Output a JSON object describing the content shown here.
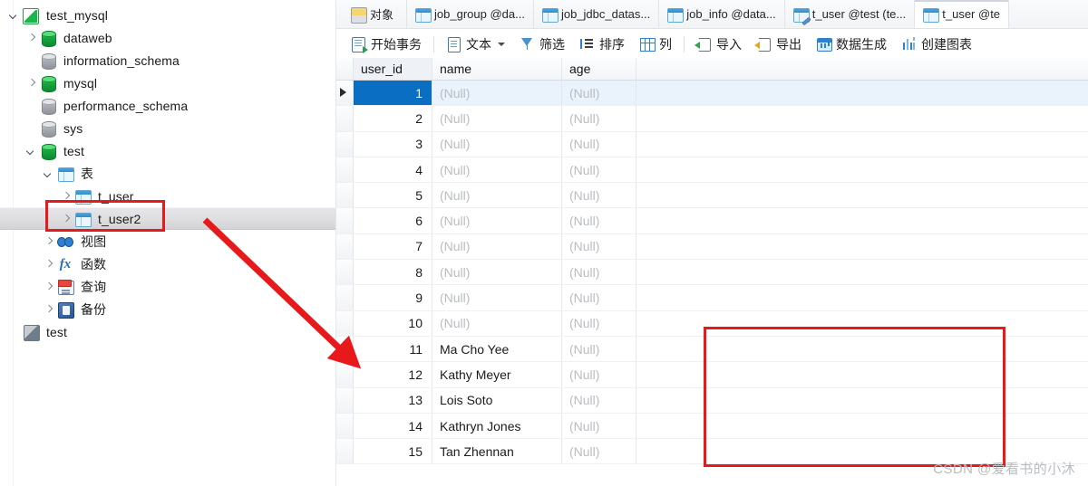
{
  "sidebar": {
    "tree": [
      {
        "label": "test_mysql",
        "icon": "connection-icon",
        "indent": 0,
        "chevron": "down",
        "selected": false,
        "cjk": false
      },
      {
        "label": "dataweb",
        "icon": "database-green-icon",
        "indent": 1,
        "chevron": "right",
        "selected": false,
        "cjk": false
      },
      {
        "label": "information_schema",
        "icon": "database-grey-icon",
        "indent": 1,
        "chevron": "none",
        "selected": false,
        "cjk": false
      },
      {
        "label": "mysql",
        "icon": "database-green-icon",
        "indent": 1,
        "chevron": "right",
        "selected": false,
        "cjk": false
      },
      {
        "label": "performance_schema",
        "icon": "database-grey-icon",
        "indent": 1,
        "chevron": "none",
        "selected": false,
        "cjk": false
      },
      {
        "label": "sys",
        "icon": "database-grey-icon",
        "indent": 1,
        "chevron": "none",
        "selected": false,
        "cjk": false
      },
      {
        "label": "test",
        "icon": "database-green-icon",
        "indent": 1,
        "chevron": "down",
        "selected": false,
        "cjk": false
      },
      {
        "label": "表",
        "icon": "table-folder-icon",
        "indent": 2,
        "chevron": "down",
        "selected": false,
        "cjk": true
      },
      {
        "label": "t_user",
        "icon": "table-icon",
        "indent": 3,
        "chevron": "right",
        "selected": false,
        "cjk": false
      },
      {
        "label": "t_user2",
        "icon": "table-icon",
        "indent": 3,
        "chevron": "right",
        "selected": true,
        "cjk": false
      },
      {
        "label": "视图",
        "icon": "view-icon",
        "indent": 2,
        "chevron": "right",
        "selected": false,
        "cjk": true
      },
      {
        "label": "函数",
        "icon": "function-icon",
        "indent": 2,
        "chevron": "right",
        "selected": false,
        "cjk": true
      },
      {
        "label": "查询",
        "icon": "query-icon",
        "indent": 2,
        "chevron": "right",
        "selected": false,
        "cjk": true
      },
      {
        "label": "备份",
        "icon": "backup-icon",
        "indent": 2,
        "chevron": "right",
        "selected": false,
        "cjk": true
      },
      {
        "label": "test",
        "icon": "model-icon",
        "indent": 0,
        "chevron": "none",
        "selected": false,
        "cjk": false
      }
    ]
  },
  "tabs": [
    {
      "label": "对象",
      "icon": "objects-icon",
      "active": false
    },
    {
      "label": "job_group @da...",
      "icon": "table-icon",
      "active": false
    },
    {
      "label": "job_jdbc_datas...",
      "icon": "table-icon",
      "active": false
    },
    {
      "label": "job_info @data...",
      "icon": "table-icon",
      "active": false
    },
    {
      "label": "t_user @test (te...",
      "icon": "table-edit-icon",
      "active": false
    },
    {
      "label": "t_user @te",
      "icon": "table-icon",
      "active": true
    }
  ],
  "toolbar": [
    {
      "label": "开始事务",
      "icon": "begin-transaction-icon",
      "caret": false,
      "sep_after": true
    },
    {
      "label": "文本",
      "icon": "text-icon",
      "caret": true,
      "sep_after": false
    },
    {
      "label": "筛选",
      "icon": "filter-icon",
      "caret": false,
      "sep_after": false
    },
    {
      "label": "排序",
      "icon": "sort-icon",
      "caret": false,
      "sep_after": false
    },
    {
      "label": "列",
      "icon": "columns-icon",
      "caret": false,
      "sep_after": true
    },
    {
      "label": "导入",
      "icon": "import-icon",
      "caret": false,
      "sep_after": false
    },
    {
      "label": "导出",
      "icon": "export-icon",
      "caret": false,
      "sep_after": false
    },
    {
      "label": "数据生成",
      "icon": "data-generation-icon",
      "caret": false,
      "sep_after": false
    },
    {
      "label": "创建图表",
      "icon": "create-chart-icon",
      "caret": false,
      "sep_after": false
    }
  ],
  "grid": {
    "columns": [
      "user_id",
      "name",
      "age"
    ],
    "null_text": "(Null)",
    "selected_row_index": 0,
    "rows": [
      {
        "user_id": "1",
        "name": "(Null)",
        "age": "(Null)"
      },
      {
        "user_id": "2",
        "name": "(Null)",
        "age": "(Null)"
      },
      {
        "user_id": "3",
        "name": "(Null)",
        "age": "(Null)"
      },
      {
        "user_id": "4",
        "name": "(Null)",
        "age": "(Null)"
      },
      {
        "user_id": "5",
        "name": "(Null)",
        "age": "(Null)"
      },
      {
        "user_id": "6",
        "name": "(Null)",
        "age": "(Null)"
      },
      {
        "user_id": "7",
        "name": "(Null)",
        "age": "(Null)"
      },
      {
        "user_id": "8",
        "name": "(Null)",
        "age": "(Null)"
      },
      {
        "user_id": "9",
        "name": "(Null)",
        "age": "(Null)"
      },
      {
        "user_id": "10",
        "name": "(Null)",
        "age": "(Null)"
      },
      {
        "user_id": "11",
        "name": "Ma Cho Yee",
        "age": "(Null)"
      },
      {
        "user_id": "12",
        "name": "Kathy Meyer",
        "age": "(Null)"
      },
      {
        "user_id": "13",
        "name": "Lois Soto",
        "age": "(Null)"
      },
      {
        "user_id": "14",
        "name": "Kathryn Jones",
        "age": "(Null)"
      },
      {
        "user_id": "15",
        "name": "Tan Zhennan",
        "age": "(Null)"
      }
    ]
  },
  "annotations": {
    "highlight_color": "#e8191b",
    "arrow_color": "#e8191b"
  },
  "watermark": "CSDN @爱看书的小沐"
}
